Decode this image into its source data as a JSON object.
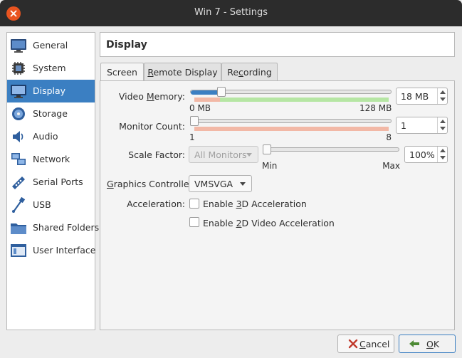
{
  "window": {
    "title": "Win 7 - Settings"
  },
  "sidebar": {
    "items": [
      {
        "label": "General",
        "icon": "monitor-general-icon",
        "active": false
      },
      {
        "label": "System",
        "icon": "chip-icon",
        "active": false
      },
      {
        "label": "Display",
        "icon": "display-monitor-icon",
        "active": true
      },
      {
        "label": "Storage",
        "icon": "disk-icon",
        "active": false
      },
      {
        "label": "Audio",
        "icon": "speaker-icon",
        "active": false
      },
      {
        "label": "Network",
        "icon": "network-icon",
        "active": false
      },
      {
        "label": "Serial Ports",
        "icon": "serial-port-icon",
        "active": false
      },
      {
        "label": "USB",
        "icon": "usb-icon",
        "active": false
      },
      {
        "label": "Shared Folders",
        "icon": "folder-icon",
        "active": false
      },
      {
        "label": "User Interface",
        "icon": "window-ui-icon",
        "active": false
      }
    ]
  },
  "header": {
    "title": "Display"
  },
  "tabs": [
    {
      "label": "Screen",
      "active": true
    },
    {
      "label": "Remote Display",
      "active": false
    },
    {
      "label": "Recording",
      "active": false
    }
  ],
  "screen": {
    "video_memory": {
      "label_pre": "Video ",
      "label_ul": "M",
      "label_post": "emory:",
      "value": "18 MB",
      "min_label": "0 MB",
      "max_label": "128 MB",
      "fraction": 0.14
    },
    "monitor_count": {
      "label": "Monitor Count:",
      "value": "1",
      "min_label": "1",
      "max_label": "8",
      "fraction": 0.0
    },
    "scale_factor": {
      "label": "Scale Factor:",
      "combo_value": "All Monitors",
      "value": "100%",
      "min_label": "Min",
      "max_label": "Max",
      "fraction": 0.0
    },
    "graphics_controller": {
      "label_ul": "G",
      "label_post": "raphics Controller:",
      "value": "VMSVGA"
    },
    "acceleration": {
      "label": "Acceleration:",
      "enable_3d_pre": "Enable ",
      "enable_3d_ul": "3",
      "enable_3d_post": "D Acceleration",
      "enable_2d_pre": "Enable ",
      "enable_2d_ul": "2",
      "enable_2d_post": "D Video Acceleration",
      "enable_3d_checked": false,
      "enable_2d_checked": false
    }
  },
  "buttons": {
    "cancel_ul": "C",
    "cancel_post": "ancel",
    "ok_ul": "O",
    "ok_post": "K"
  },
  "colors": {
    "accent": "#3b7fc2",
    "close": "#e95420",
    "titlebar": "#2c2c2c"
  }
}
